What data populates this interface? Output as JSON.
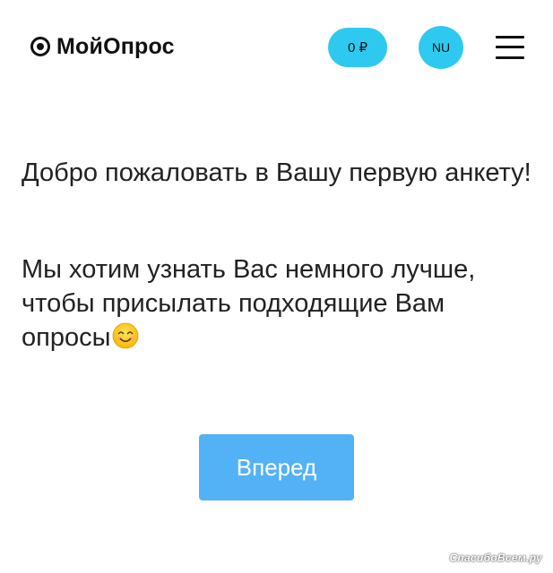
{
  "header": {
    "brand": "МойОпрос",
    "balance": "0 ₽",
    "user_initials": "NU"
  },
  "main": {
    "welcome_text": "Добро пожаловать в Вашу первую анкету!",
    "intro_text": "Мы хотим узнать Вас немного лучше, чтобы присылать подходящие Вам опросы",
    "next_button_label": "Вперед"
  },
  "watermark": "СпасибоВсем.ру",
  "colors": {
    "accent_cyan": "#2ec9f0",
    "button_blue": "#52b2f5",
    "text": "#222222"
  },
  "icons": {
    "logo": "target-dot-icon",
    "menu": "hamburger-menu-icon",
    "emoji": "smiling-face-icon"
  }
}
